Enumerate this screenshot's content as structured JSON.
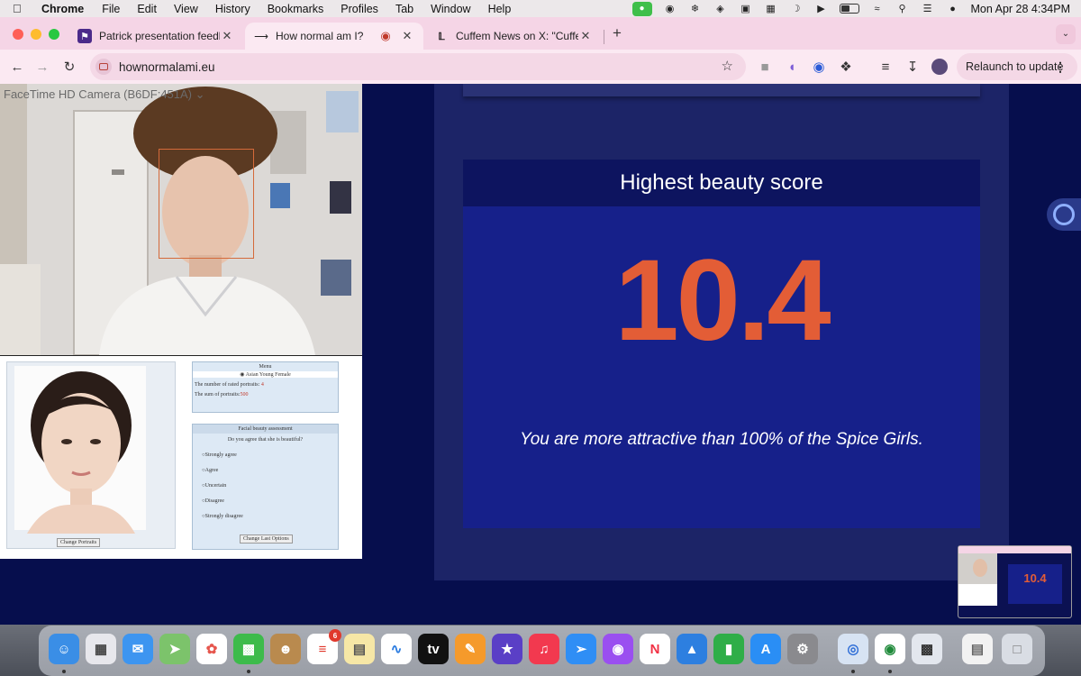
{
  "menubar": {
    "app_name": "Chrome",
    "items": [
      "File",
      "Edit",
      "View",
      "History",
      "Bookmarks",
      "Profiles",
      "Tab",
      "Window",
      "Help"
    ],
    "clock": "Mon Apr 28  4:34PM"
  },
  "tabs": [
    {
      "title": "Patrick presentation feedback",
      "active": false
    },
    {
      "title": "How normal am I?",
      "active": true
    },
    {
      "title": "Cuffem News on X: \"Cuffem g",
      "active": false
    }
  ],
  "toolbar": {
    "url": "hownormalami.eu",
    "relaunch_label": "Relaunch to update"
  },
  "camera": {
    "label": "FaceTime HD Camera (B6DF:451A)"
  },
  "portrait_panel": {
    "menu_title": "Menu",
    "selected_category": "Asian Young Female",
    "rated_label": "The number of rated portraits:",
    "rated_value": "4",
    "sum_label": "The sum of portraits:",
    "sum_value": "500",
    "assessment_title": "Facial beauty assessment",
    "question": "Do you agree that she is beautiful?",
    "options": [
      "Strongly agree",
      "Agree",
      "Uncertain",
      "Disagree",
      "Strongly disagree"
    ],
    "change_portraits_label": "Change Portraits",
    "change_last_label": "Change Last Options"
  },
  "score": {
    "heading": "Highest beauty score",
    "value": "10.4",
    "message": "You are more attractive than 100% of the Spice Girls."
  },
  "pip": {
    "score": "10.4"
  },
  "dock": {
    "badge_count": "6"
  },
  "colors": {
    "page_bg": "#060e4d",
    "card_bg": "#16208a",
    "score_color": "#e35d36",
    "tab_strip": "#f5d5e6"
  }
}
